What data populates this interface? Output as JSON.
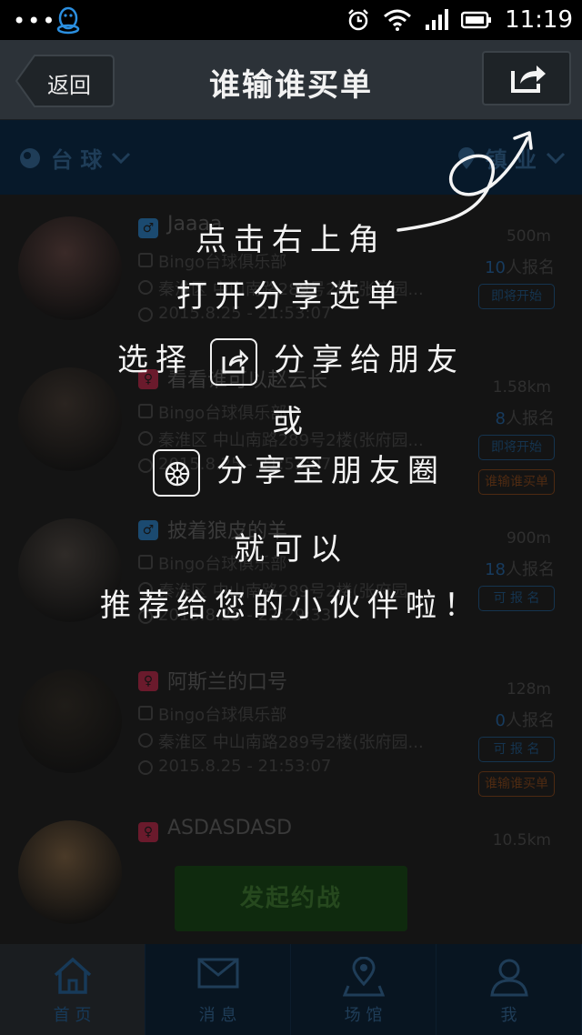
{
  "status_bar": {
    "time": "11:19",
    "dots": "•••"
  },
  "header": {
    "back_label": "返回",
    "title": "谁输谁买单"
  },
  "filter": {
    "left_label": "台 球",
    "right_label": "镇 业"
  },
  "list": [
    {
      "gender": "♂",
      "gender_type": "male",
      "title": "Jaaaa",
      "club": "Bingo台球俱乐部",
      "address": "秦淮区 中山南路289号2楼(张府园...",
      "time": "2015.8.25 - 21:53:07",
      "distance": "500m",
      "signup_count": "10",
      "signup_text": "人报名",
      "tags": [
        {
          "label": "即将开始",
          "color": "blue"
        }
      ]
    },
    {
      "gender": "♀",
      "gender_type": "female",
      "title": "看看谁可以赵云长",
      "club": "Bingo台球俱乐部",
      "address": "秦淮区 中山南路289号2楼(张府园...",
      "time": "2015.8.25 - 21:53:07",
      "distance": "1.58km",
      "signup_count": "8",
      "signup_text": "人报名",
      "tags": [
        {
          "label": "即将开始",
          "color": "blue"
        },
        {
          "label": "谁输谁买单",
          "color": "orange"
        }
      ]
    },
    {
      "gender": "♂",
      "gender_type": "male",
      "title": "披着狼皮的羊",
      "club": "Bingo台球俱乐部",
      "address": "秦淮区 中山南路289号2楼(张府园...",
      "time": "2015.8.25 - 22:29:33",
      "distance": "900m",
      "signup_count": "18",
      "signup_text": "人报名",
      "tags": [
        {
          "label": "可 报 名",
          "color": "blue"
        }
      ]
    },
    {
      "gender": "♀",
      "gender_type": "female",
      "title": "阿斯兰的口号",
      "club": "Bingo台球俱乐部",
      "address": "秦淮区 中山南路289号2楼(张府园...",
      "time": "2015.8.25 - 21:53:07",
      "distance": "128m",
      "signup_count": "0",
      "signup_text": "人报名",
      "tags": [
        {
          "label": "可 报 名",
          "color": "blue"
        },
        {
          "label": "谁输谁买单",
          "color": "orange"
        }
      ]
    },
    {
      "gender": "♀",
      "gender_type": "female",
      "title": "ASDASDASD",
      "club": "",
      "address": "",
      "time": "",
      "distance": "10.5km",
      "signup_count": "",
      "signup_text": "",
      "tags": []
    }
  ],
  "cta": {
    "label": "发起约战"
  },
  "tabs": [
    {
      "label": "首 页",
      "icon": "home-icon"
    },
    {
      "label": "消 息",
      "icon": "mail-icon"
    },
    {
      "label": "场 馆",
      "icon": "location-icon"
    },
    {
      "label": "我",
      "icon": "user-icon"
    }
  ],
  "guide": {
    "line1": "点击右上角",
    "line2": "打开分享选单",
    "line3_prefix": "选择",
    "line3_suffix": "分享给朋友",
    "line4": "或",
    "line5_suffix": "分享至朋友圈",
    "line6": "就可以",
    "line7": "推荐给您的小伙伴啦！"
  }
}
